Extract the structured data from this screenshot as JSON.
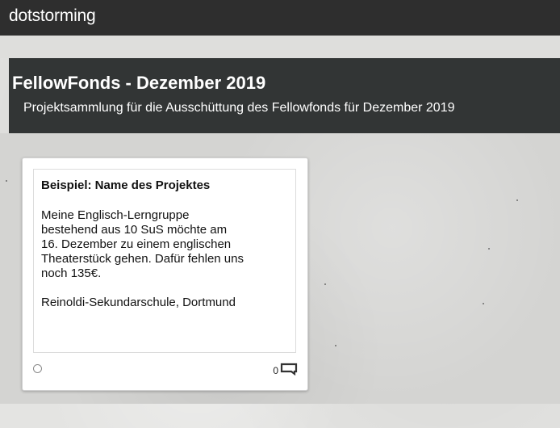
{
  "app": {
    "brand": "dotstorming"
  },
  "board": {
    "title": "FellowFonds - Dezember 2019",
    "subtitle": "Projektsammlung für die Ausschüttung des Fellowfonds für Dezember 2019"
  },
  "card": {
    "title": "Beispiel: Name des Projektes",
    "body": "Meine Englisch-Lerngruppe\nbestehend aus 10 SuS möchte am\n16. Dezember zu einem englischen\nTheaterstück gehen. Dafür fehlen uns\nnoch 135€.\n\nReinoldi-Sekundarschule, Dortmund",
    "comment_count": "0",
    "vote_icon": "circle-outline-icon",
    "comment_icon": "comment-icon"
  },
  "colors": {
    "topbar": "#2e2e2e",
    "board_header": "#323535",
    "background": "#e4e4e2",
    "card": "#ffffff"
  }
}
